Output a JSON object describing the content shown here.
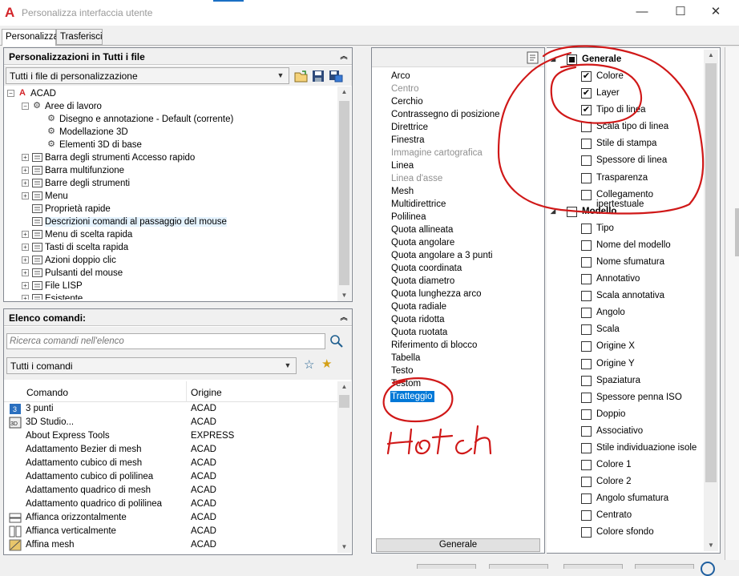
{
  "window": {
    "title": "Personalizza interfaccia utente",
    "app_icon": "autocad-a-icon",
    "controls": {
      "minimize": "—",
      "maximize": "☐",
      "close": "✕"
    }
  },
  "tabs": [
    {
      "label": "Personalizza",
      "active": true
    },
    {
      "label": "Trasferisci",
      "active": false
    }
  ],
  "customizations_panel": {
    "header": "Personalizzazioni in Tutti i file",
    "filter_value": "Tutti i file di personalizzazione",
    "tree": [
      {
        "label": "ACAD",
        "level": 0,
        "exp": "−",
        "icon": "acad-icon"
      },
      {
        "label": "Aree di lavoro",
        "level": 1,
        "exp": "−",
        "icon": "gear-icon"
      },
      {
        "label": "Disegno e annotazione - Default (corrente)",
        "level": 2,
        "exp": "",
        "icon": "gear-icon"
      },
      {
        "label": "Modellazione 3D",
        "level": 2,
        "exp": "",
        "icon": "gear-icon"
      },
      {
        "label": "Elementi 3D di base",
        "level": 2,
        "exp": "",
        "icon": "gear-icon"
      },
      {
        "label": "Barra degli strumenti Accesso rapido",
        "level": 1,
        "exp": "+",
        "icon": "toolbar-icon"
      },
      {
        "label": "Barra multifunzione",
        "level": 1,
        "exp": "+",
        "icon": "ribbon-icon"
      },
      {
        "label": "Barre degli strumenti",
        "level": 1,
        "exp": "+",
        "icon": "toolbar-icon"
      },
      {
        "label": "Menu",
        "level": 1,
        "exp": "+",
        "icon": "menu-icon"
      },
      {
        "label": "Proprietà rapide",
        "level": 1,
        "exp": "",
        "icon": "quick-properties-icon"
      },
      {
        "label": "Descrizioni comandi al passaggio del mouse",
        "level": 1,
        "exp": "",
        "icon": "rollover-tooltip-icon",
        "selected": true
      },
      {
        "label": "Menu di scelta rapida",
        "level": 1,
        "exp": "+",
        "icon": "shortcut-menu-icon"
      },
      {
        "label": "Tasti di scelta rapida",
        "level": 1,
        "exp": "+",
        "icon": "keyboard-shortcut-icon"
      },
      {
        "label": "Azioni doppio clic",
        "level": 1,
        "exp": "+",
        "icon": "double-click-icon"
      },
      {
        "label": "Pulsanti del mouse",
        "level": 1,
        "exp": "+",
        "icon": "mouse-icon"
      },
      {
        "label": "File LISP",
        "level": 1,
        "exp": "+",
        "icon": "lisp-file-icon"
      },
      {
        "label": "Esistente",
        "level": 1,
        "exp": "+",
        "icon": "legacy-icon"
      }
    ]
  },
  "commands_panel": {
    "header": "Elenco comandi:",
    "search_placeholder": "Ricerca comandi nell'elenco",
    "filter_value": "Tutti i comandi",
    "columns": {
      "name": "Comando",
      "origin": "Origine"
    },
    "rows": [
      {
        "name": "3 punti",
        "origin": "ACAD"
      },
      {
        "name": "3D Studio...",
        "origin": "ACAD"
      },
      {
        "name": "About Express Tools",
        "origin": "EXPRESS"
      },
      {
        "name": "Adattamento Bezier di mesh",
        "origin": "ACAD"
      },
      {
        "name": "Adattamento cubico di mesh",
        "origin": "ACAD"
      },
      {
        "name": "Adattamento cubico di polilinea",
        "origin": "ACAD"
      },
      {
        "name": "Adattamento quadrico di mesh",
        "origin": "ACAD"
      },
      {
        "name": "Adattamento quadrico di polilinea",
        "origin": "ACAD"
      },
      {
        "name": "Affianca orizzontalmente",
        "origin": "ACAD"
      },
      {
        "name": "Affianca verticalmente",
        "origin": "ACAD"
      },
      {
        "name": "Affina mesh",
        "origin": "ACAD"
      }
    ]
  },
  "object_types": {
    "items": [
      {
        "label": "Arco"
      },
      {
        "label": "Centro",
        "disabled": true
      },
      {
        "label": "Cerchio"
      },
      {
        "label": "Contrassegno di posizione"
      },
      {
        "label": "Direttrice"
      },
      {
        "label": "Finestra"
      },
      {
        "label": "Immagine cartografica",
        "disabled": true
      },
      {
        "label": "Linea"
      },
      {
        "label": "Linea d'asse",
        "disabled": true
      },
      {
        "label": "Mesh"
      },
      {
        "label": "Multidirettrice"
      },
      {
        "label": "Polilinea"
      },
      {
        "label": "Quota allineata"
      },
      {
        "label": "Quota angolare"
      },
      {
        "label": "Quota angolare a 3 punti"
      },
      {
        "label": "Quota coordinata"
      },
      {
        "label": "Quota diametro"
      },
      {
        "label": "Quota lunghezza arco"
      },
      {
        "label": "Quota radiale"
      },
      {
        "label": "Quota ridotta"
      },
      {
        "label": "Quota ruotata"
      },
      {
        "label": "Riferimento di blocco"
      },
      {
        "label": "Tabella"
      },
      {
        "label": "Testo"
      },
      {
        "label": "Testom"
      },
      {
        "label": "Tratteggio",
        "selected": true
      }
    ],
    "footer_button": "Generale"
  },
  "properties": {
    "rows": [
      {
        "type": "group",
        "label": "Generale",
        "state": "partial"
      },
      {
        "label": "Colore",
        "checked": true
      },
      {
        "label": "Layer",
        "checked": true
      },
      {
        "label": "Tipo di linea",
        "checked": true
      },
      {
        "label": "Scala tipo di linea",
        "checked": false
      },
      {
        "label": "Stile di stampa",
        "checked": false
      },
      {
        "label": "Spessore di linea",
        "checked": false
      },
      {
        "label": "Trasparenza",
        "checked": false
      },
      {
        "label": "Collegamento ipertestuale",
        "checked": false
      },
      {
        "type": "group",
        "label": "Modello",
        "state": "none"
      },
      {
        "label": "Tipo",
        "checked": false
      },
      {
        "label": "Nome del modello",
        "checked": false
      },
      {
        "label": "Nome sfumatura",
        "checked": false
      },
      {
        "label": "Annotativo",
        "checked": false
      },
      {
        "label": "Scala annotativa",
        "checked": false
      },
      {
        "label": "Angolo",
        "checked": false
      },
      {
        "label": "Scala",
        "checked": false
      },
      {
        "label": "Origine X",
        "checked": false
      },
      {
        "label": "Origine Y",
        "checked": false
      },
      {
        "label": "Spaziatura",
        "checked": false
      },
      {
        "label": "Spessore penna ISO",
        "checked": false
      },
      {
        "label": "Doppio",
        "checked": false
      },
      {
        "label": "Associativo",
        "checked": false
      },
      {
        "label": "Stile individuazione isole",
        "checked": false
      },
      {
        "label": "Colore 1",
        "checked": false
      },
      {
        "label": "Colore 2",
        "checked": false
      },
      {
        "label": "Angolo sfumatura",
        "checked": false
      },
      {
        "label": "Centrato",
        "checked": false
      },
      {
        "label": "Colore sfondo",
        "checked": false
      }
    ]
  },
  "annotation": {
    "handwritten_text": "Hatch",
    "ink_color": "#d01818"
  },
  "colors": {
    "selection": "#0078d7",
    "tree_selection": "#e5f3ff",
    "brand_red": "#d3252a"
  }
}
